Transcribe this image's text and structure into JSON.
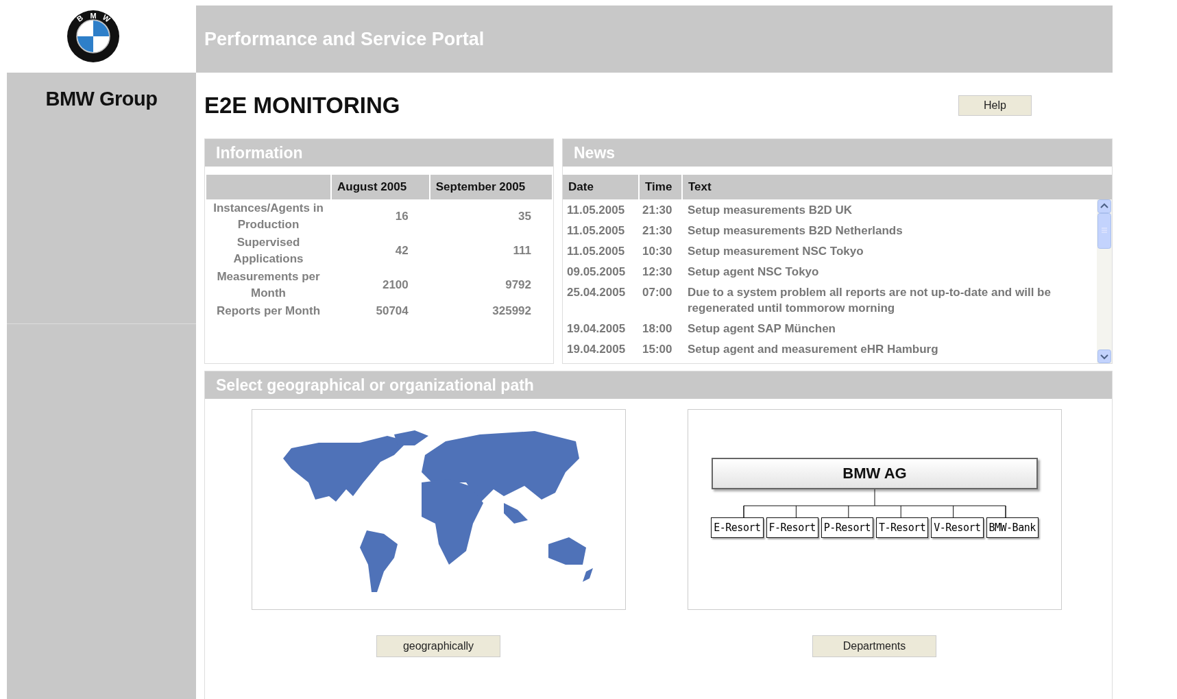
{
  "logo": {
    "letters": [
      "B",
      "M",
      "W"
    ]
  },
  "sidebar": {
    "brand": "BMW Group"
  },
  "header": {
    "title": "Performance and Service Portal"
  },
  "page": {
    "heading": "E2E MONITORING",
    "help_button": "Help"
  },
  "information": {
    "title": "Information",
    "columns": [
      "August 2005",
      "September 2005"
    ],
    "rows": [
      {
        "label": "Instances/Agents in Production",
        "values": [
          "16",
          "35"
        ]
      },
      {
        "label": "Supervised Applications",
        "values": [
          "42",
          "111"
        ]
      },
      {
        "label": "Measurements per Month",
        "values": [
          "2100",
          "9792"
        ]
      },
      {
        "label": "Reports per Month",
        "values": [
          "50704",
          "325992"
        ]
      }
    ]
  },
  "news": {
    "title": "News",
    "columns": [
      "Date",
      "Time",
      "Text"
    ],
    "rows": [
      {
        "date": "11.05.2005",
        "time": "21:30",
        "text": "Setup measurements B2D UK"
      },
      {
        "date": "11.05.2005",
        "time": "21:30",
        "text": "Setup measurements B2D Netherlands"
      },
      {
        "date": "11.05.2005",
        "time": "10:30",
        "text": "Setup measurement NSC Tokyo"
      },
      {
        "date": "09.05.2005",
        "time": "12:30",
        "text": "Setup agent NSC Tokyo"
      },
      {
        "date": "25.04.2005",
        "time": "07:00",
        "text": "Due to a system problem all reports are not up-to-date and will be regenerated until tommorow morning"
      },
      {
        "date": "19.04.2005",
        "time": "18:00",
        "text": "Setup agent SAP München"
      },
      {
        "date": "19.04.2005",
        "time": "15:00",
        "text": "Setup agent and measurement eHR Hamburg"
      }
    ]
  },
  "path": {
    "title": "Select geographical or organizational path",
    "geo_button": "geographically",
    "org": {
      "root": "BMW AG",
      "departments": [
        "E-Resort",
        "F-Resort",
        "P-Resort",
        "T-Resort",
        "V-Resort",
        "BMW-Bank"
      ]
    },
    "org_button": "Departments"
  }
}
